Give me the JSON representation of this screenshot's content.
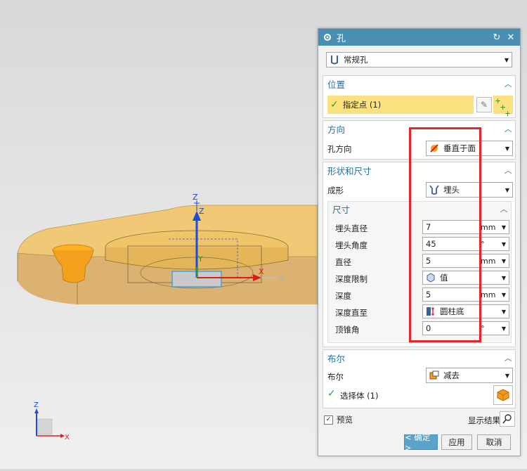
{
  "viewport": {
    "axes_main": {
      "z1": "Z",
      "z2": "Z",
      "y": "Y",
      "x": "X"
    },
    "axes_small": {
      "z": "Z",
      "x": "X"
    }
  },
  "dialog": {
    "title": "孔",
    "hole_type": "常规孔",
    "position": {
      "header": "位置",
      "specify_point": "指定点 (1)"
    },
    "direction": {
      "header": "方向",
      "label": "孔方向",
      "value": "垂直于面"
    },
    "shape": {
      "header": "形状和尺寸",
      "form_label": "成形",
      "form_value": "埋头",
      "dimensions": {
        "header": "尺寸",
        "rows": [
          {
            "label": "埋头直径",
            "value": "7",
            "unit": "mm"
          },
          {
            "label": "埋头角度",
            "value": "45",
            "unit": "°"
          },
          {
            "label": "直径",
            "value": "5",
            "unit": "mm"
          },
          {
            "label": "深度限制",
            "value": "值",
            "unit": ""
          },
          {
            "label": "深度",
            "value": "5",
            "unit": "mm"
          },
          {
            "label": "深度直至",
            "value": "圆柱底",
            "unit": ""
          },
          {
            "label": "顶锥角",
            "value": "0",
            "unit": "°"
          }
        ]
      }
    },
    "boolean": {
      "header": "布尔",
      "label": "布尔",
      "value": "减去",
      "select_body": "选择体 (1)"
    },
    "preview": "预览",
    "show_result": "显示结果",
    "ok": "< 确定 >",
    "apply": "应用",
    "cancel": "取消"
  },
  "colors": {
    "title_bar": "#4a8fb3",
    "highlight": "#fce17f",
    "annotation": "#e8252b",
    "part": "#f2c66a"
  }
}
